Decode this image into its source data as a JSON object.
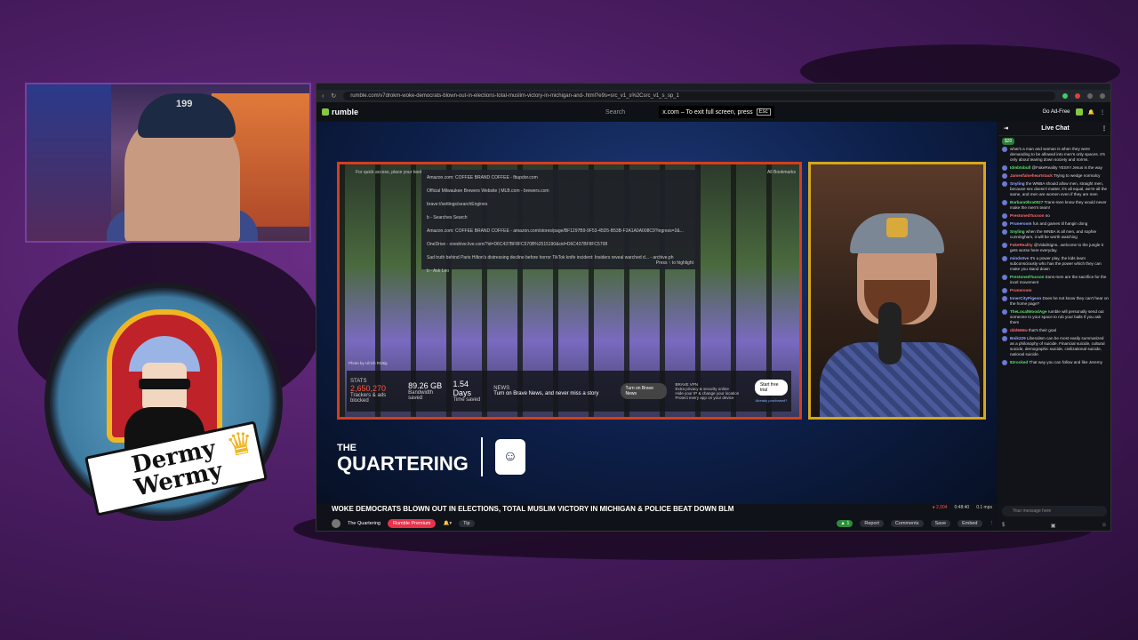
{
  "webcam": {
    "cap_logo": "199"
  },
  "logo": {
    "line1": "Dermy",
    "line2": "Wermy",
    "crown_icon": "crown-icon"
  },
  "browser": {
    "url": "rumble.com/v7drokm-woke-democrats-blown-out-in-elections-total-muslim-victory-in-michigan-and-.html?e9s=src_v1_s%2Csrc_v1_s_sp_1",
    "rumble_logo": "rumble",
    "search_label": "Search",
    "fullscreen_msg": "x.com – To exit full screen, press",
    "esc_key": "Esc",
    "go_adfree": "Go Ad-Free"
  },
  "stream_screen": {
    "quick_access": "For quick access, place your bookm",
    "all_bookmarks": "All Bookmarks",
    "dropdown": [
      "Amazon.com: COFFEE BRAND COFFEE - fbupdor.com",
      "Official Milwaukee Brewers Website | MLB.com - brewers.com",
      "brave://settings/searchEngines",
      "b - Searches Search",
      "Amazon.com: COFFEE BRAND COFFEE - amazon.com/stores/page/BF1297B9-9F53-45D5-B53B-F2A1A0A008C9?ingress=2&...",
      "OneDrive - onedrive.live.com/?id=D6C437BF8FC570B%2515190&cid=D6C437BF8FC5708",
      "Sad truth behind Paris Hilton's distressing decline before horror TikTok knife incident: Insiders reveal warched d... - archive.ph",
      "b - Ask Leo"
    ],
    "tab_hint": "Press ↑ to highlight",
    "photo_credit": "Photo by Ulrich Rüttig",
    "stats_label": "STATS",
    "trackers_value": "2,650,270",
    "trackers_label": "Trackers & ads blocked",
    "bandwidth_value": "89.26 GB",
    "bandwidth_label": "Bandwidth saved",
    "time_value": "1.54 Days",
    "time_label": "Time saved",
    "news_label": "NEWS",
    "news_text": "Turn on Brave News, and never miss a story",
    "news_button": "Turn on Brave News",
    "vpn_label": "BRAVE VPN",
    "vpn_lines": [
      "Extra privacy & security online",
      "Hide your IP & change your location",
      "Protect every app on your device"
    ],
    "vpn_button": "Start free trial",
    "vpn_restore": "Already purchased?"
  },
  "overlay": {
    "brand_small": "THE",
    "brand_big": "QUARTERING"
  },
  "video": {
    "title": "WOKE DEMOCRATS BLOWN OUT IN ELECTIONS, TOTAL MUSLIM VICTORY IN MICHIGAN & POLICE BEAT DOWN BLM",
    "channel": "The Quartering",
    "premium_button": "Rumble Premium",
    "tip_button": "Tip",
    "viewers": "2,904",
    "duration": "0:48:40",
    "bitrate": "0.1 mps",
    "rumbles": "1",
    "report": "Report",
    "comments": "Comments",
    "save": "Save",
    "embed": "Embed"
  },
  "chat": {
    "title": "Live Chat",
    "rant": "$20",
    "placeholder": "Your message here",
    "messages": [
      {
        "user": "",
        "text": "what's a man and woman is when they were demanding to be allowed into men's only spaces. It's only about tearing down society and norms."
      },
      {
        "user": "Idmbtsbull",
        "text": "@FakeReality YES!!!! Jesus is the way"
      },
      {
        "user": "Jamesfalseheartstack",
        "text": "Trying to wedge normalcy"
      },
      {
        "user": "Snyling",
        "text": "the WNBA should allow men, straight men, because sex doesn't matter, it's all equal, we're all the same, and men are women even if they are men"
      },
      {
        "user": "Barbara0bra0027",
        "text": "Trans-men know they would never make the men's team!"
      },
      {
        "user": "PrestonedTucson",
        "text": "no"
      },
      {
        "user": "Pruneroom",
        "text": "fun and games til hangin dong"
      },
      {
        "user": "Snyling",
        "text": "when the WNBA is all men, and sophie cunningham, it will be worth watching"
      },
      {
        "user": "FakeReality",
        "text": "@VidalSigns...welcome to the jungle it gets worse here everyday."
      },
      {
        "user": "minds0ve",
        "text": "It's a power play, the kids learn subconsciously who has the power which they can make you stand down"
      },
      {
        "user": "PrestonedTucson",
        "text": "trans-men are the sacrifice for the incel movement"
      },
      {
        "user": "Pruneroom",
        "text": ""
      },
      {
        "user": "InnerCityPigeon",
        "text": "Does he not know they can't hear on the home page?"
      },
      {
        "user": "TheLocalWoodAge",
        "text": "rumble will personally send out someone to your space to rub your balls if you ask them"
      },
      {
        "user": "ddd666w",
        "text": "that's their goal"
      },
      {
        "user": "Bnik229",
        "text": "Liberalism can be most easily summarized as a philosophy of suicide. Financial suicide, cultural suicide, demographic suicide, civilizational suicide, national suicide."
      },
      {
        "user": "82rocked",
        "text": "That way you can follow and like Jeremy"
      }
    ]
  }
}
